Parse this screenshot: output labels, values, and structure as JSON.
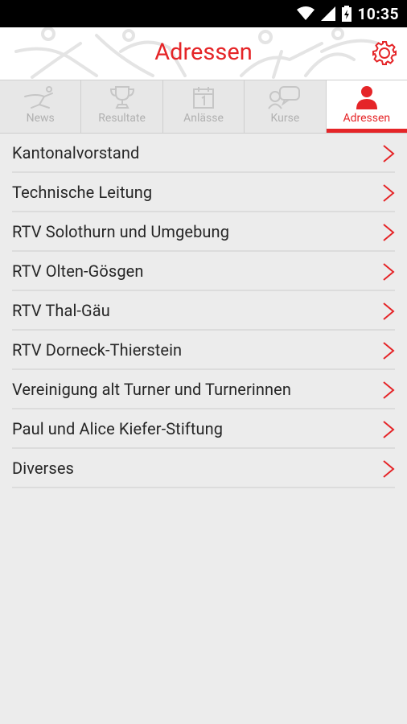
{
  "status_bar": {
    "time": "10:35"
  },
  "header": {
    "title": "Adressen"
  },
  "tabs": [
    {
      "label": "News",
      "icon": "runner-icon"
    },
    {
      "label": "Resultate",
      "icon": "trophy-icon"
    },
    {
      "label": "Anlässe",
      "icon": "calendar-icon"
    },
    {
      "label": "Kurse",
      "icon": "chat-icon"
    },
    {
      "label": "Adressen",
      "icon": "person-icon"
    }
  ],
  "active_tab": "Adressen",
  "list": {
    "items": [
      "Kantonalvorstand",
      "Technische Leitung",
      "RTV Solothurn und Umgebung",
      "RTV Olten-Gösgen",
      "RTV Thal-Gäu",
      "RTV Dorneck-Thierstein",
      "Vereinigung alt Turner und Turnerinnen",
      "Paul und Alice Kiefer-Stiftung",
      "Diverses"
    ]
  },
  "colors": {
    "accent": "#e52528",
    "tab_inactive": "#b0b0b0",
    "background": "#ececec"
  }
}
